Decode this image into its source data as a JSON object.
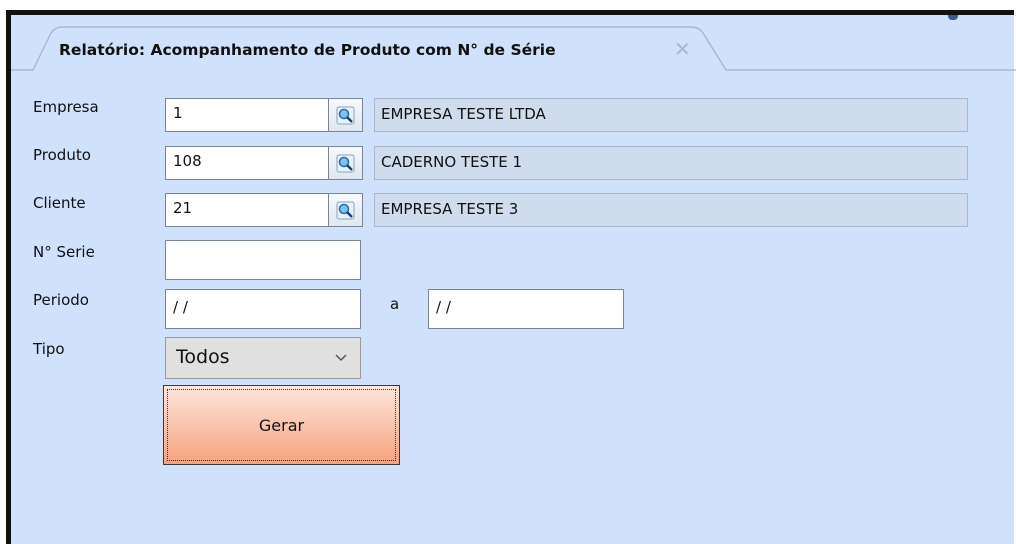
{
  "tab": {
    "title": "Relatório: Acompanhamento de Produto com N° de Série",
    "close_glyph": "✕"
  },
  "form": {
    "empresa": {
      "label": "Empresa",
      "code": "1",
      "description": "EMPRESA TESTE LTDA"
    },
    "produto": {
      "label": "Produto",
      "code": "108",
      "description": "CADERNO TESTE 1"
    },
    "cliente": {
      "label": "Cliente",
      "code": "21",
      "description": "EMPRESA TESTE 3"
    },
    "serie": {
      "label": "N° Serie",
      "value": ""
    },
    "periodo": {
      "label": "Periodo",
      "from": " / /",
      "separator": "a",
      "to": " / /"
    },
    "tipo": {
      "label": "Tipo",
      "selected": "Todos"
    }
  },
  "actions": {
    "generate_label": "Gerar"
  },
  "icons": {
    "lookup": "magnifier-icon",
    "dropdown": "chevron-down-icon",
    "close": "close-icon"
  },
  "colors": {
    "panel": "#cfe1fb",
    "button_top": "#fde6dc",
    "button_bottom": "#f6a27e",
    "readonly": "#cfdcee"
  }
}
